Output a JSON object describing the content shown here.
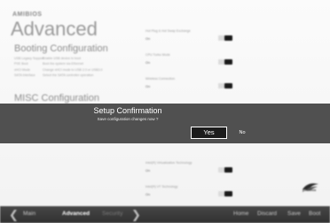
{
  "brand": "AMIBIOS",
  "page_title": "Advanced",
  "booting": {
    "title": "Booting Configuration",
    "rows": [
      {
        "key": "USB Legacy Support",
        "value": "Enable USB device to boot"
      },
      {
        "key": "PXE Boot",
        "value": "Boot the system via Ethernet"
      },
      {
        "key": "xHCI Mode",
        "value": "Change xHCI mode to USB 2.0 or USB3.0"
      },
      {
        "key": "SATA Interface",
        "value": "Select the SATA controller operation"
      }
    ]
  },
  "misc_title": "MISC Configuration",
  "settings": [
    {
      "name": "Hot Plug & Hot Swap Exchange",
      "value": "On"
    },
    {
      "name": "CPU Turbo Mode",
      "value": "On"
    },
    {
      "name": "Wireless Connection",
      "value": "On"
    },
    {
      "name": "Intel(R) Virtualization Technology",
      "value": "On"
    },
    {
      "name": "Intel(R) VT Technology",
      "value": "On"
    }
  ],
  "dialog": {
    "title": "Setup Confirmation",
    "message": "Save configuration changes now ?",
    "yes_label": "Yes",
    "no_label": "No"
  },
  "logo_text": "phoenix",
  "footer": {
    "nav": [
      "Main",
      "Advanced",
      "Security"
    ],
    "actions": [
      "Home",
      "Discard",
      "Save",
      "Boot"
    ]
  },
  "colors": {
    "dialog_bg": "#505050",
    "footer_bg": "#3a3a3a",
    "toggle_knob": "#1a1a1a"
  }
}
